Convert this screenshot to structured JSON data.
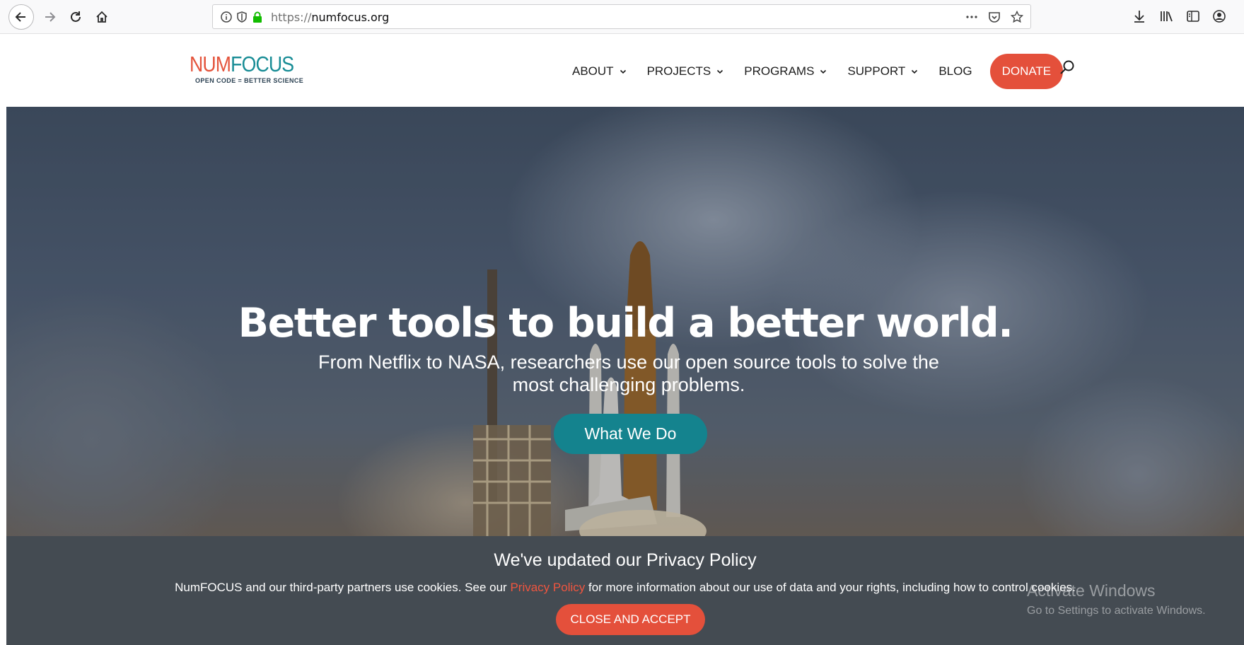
{
  "browser": {
    "url_scheme": "https://",
    "url_host": "numfocus.org"
  },
  "site": {
    "logo_num": "NUM",
    "logo_focus": "FOCUS",
    "logo_tagline": "OPEN CODE = BETTER SCIENCE",
    "nav": {
      "about": "ABOUT",
      "projects": "PROJECTS",
      "programs": "PROGRAMS",
      "support": "SUPPORT",
      "blog": "BLOG",
      "donate": "DONATE"
    }
  },
  "hero": {
    "title": "Better tools to build a better world.",
    "subtitle": "From Netflix to NASA, researchers use our open source tools to solve the most challenging problems.",
    "cta": "What We Do"
  },
  "cookie": {
    "title": "We've updated our Privacy Policy",
    "text_before": "NumFOCUS and our third-party partners use cookies. See our ",
    "link": "Privacy Policy",
    "text_after": " for more information about our use of data and your rights, including how to control cookies.",
    "button": "CLOSE AND ACCEPT"
  },
  "watermark": {
    "title": "Activate Windows",
    "subtitle": "Go to Settings to activate Windows."
  },
  "colors": {
    "brand_red": "#e4503b",
    "brand_teal": "#14838e",
    "cookie_bar": "#444b52"
  }
}
